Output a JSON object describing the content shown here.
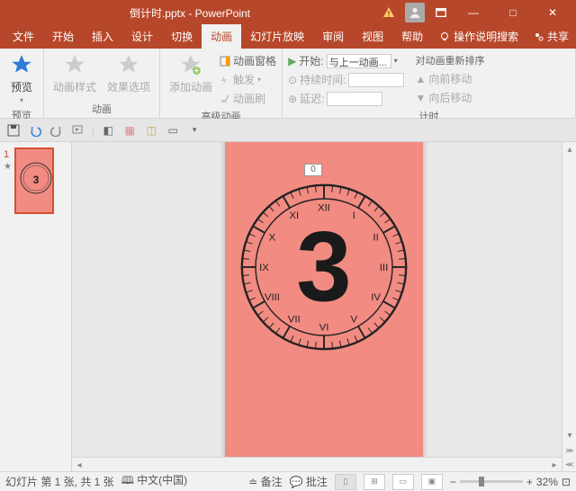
{
  "title": "倒计时.pptx - PowerPoint",
  "win_controls": {
    "min": "—",
    "max": "□",
    "close": "✕"
  },
  "tabs": [
    "文件",
    "开始",
    "插入",
    "设计",
    "切换",
    "动画",
    "幻灯片放映",
    "审阅",
    "视图",
    "帮助"
  ],
  "active_tab": "动画",
  "tellme": "操作说明搜索",
  "share": "共享",
  "ribbon": {
    "preview_group": {
      "btn": "预览",
      "label": "预览"
    },
    "anim_group": {
      "b1": "动画样式",
      "b2": "效果选项",
      "b3": "添加动画",
      "label": "动画"
    },
    "adv_anim_group": {
      "pane": "动画窗格",
      "trigger": "触发",
      "painter": "动画刷",
      "label": "高级动画"
    },
    "timing_group": {
      "start": "开始:",
      "start_val": "与上一动画...",
      "duration": "持续时间:",
      "duration_val": "",
      "delay": "延迟:",
      "delay_val": "",
      "reorder": "对动画重新排序",
      "move_up": "向前移动",
      "move_down": "向后移动",
      "label": "计时"
    }
  },
  "slide_panel": {
    "num": "1",
    "star": "★"
  },
  "slide": {
    "big_number": "3",
    "handle": "0"
  },
  "clock_numerals": [
    "XII",
    "I",
    "II",
    "III",
    "IV",
    "V",
    "VI",
    "VII",
    "VIII",
    "IX",
    "X",
    "XI"
  ],
  "status": {
    "slide_count": "幻灯片 第 1 张, 共 1 张",
    "lang": "中文(中国)",
    "notes": "备注",
    "comments": "批注",
    "zoom": "32%",
    "fit": "⊡"
  }
}
